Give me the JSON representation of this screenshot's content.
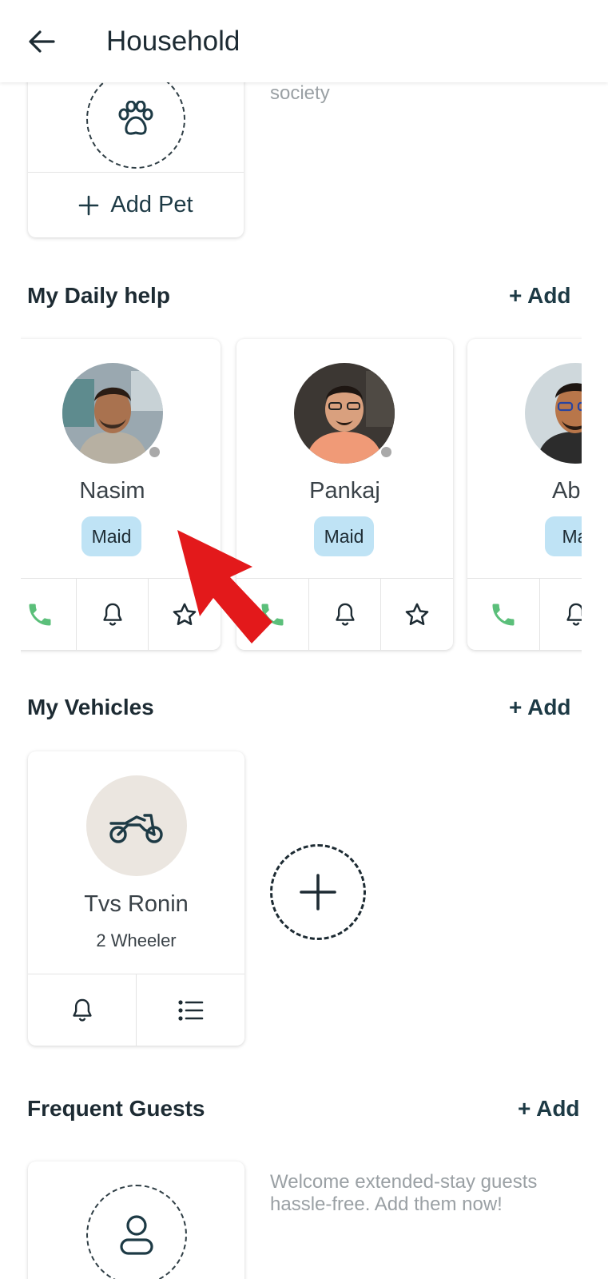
{
  "header": {
    "title": "Household"
  },
  "pets": {
    "add_label": "Add Pet",
    "note": "society"
  },
  "daily_help": {
    "title": "My Daily help",
    "add_label": "+ Add",
    "members": [
      {
        "name": "Nasim",
        "role": "Maid"
      },
      {
        "name": "Pankaj",
        "role": "Maid"
      },
      {
        "name": "Abh",
        "role": "Ma"
      }
    ]
  },
  "vehicles": {
    "title": "My Vehicles",
    "add_label": "+ Add",
    "items": [
      {
        "name": "Tvs Ronin",
        "type": "2 Wheeler"
      }
    ]
  },
  "guests": {
    "title": "Frequent Guests",
    "add_label": "+ Add",
    "note": "Welcome extended-stay guests hassle-free. Add them now!"
  },
  "colors": {
    "accent_dark": "#1d3a45",
    "phone_green": "#5bbf7a",
    "pill_blue": "#bfe3f5",
    "annotation_red": "#e3191b"
  },
  "icons": [
    "back-arrow-icon",
    "paw-icon",
    "plus-icon",
    "phone-icon",
    "bell-icon",
    "star-icon",
    "motorbike-icon",
    "list-icon",
    "person-icon"
  ]
}
